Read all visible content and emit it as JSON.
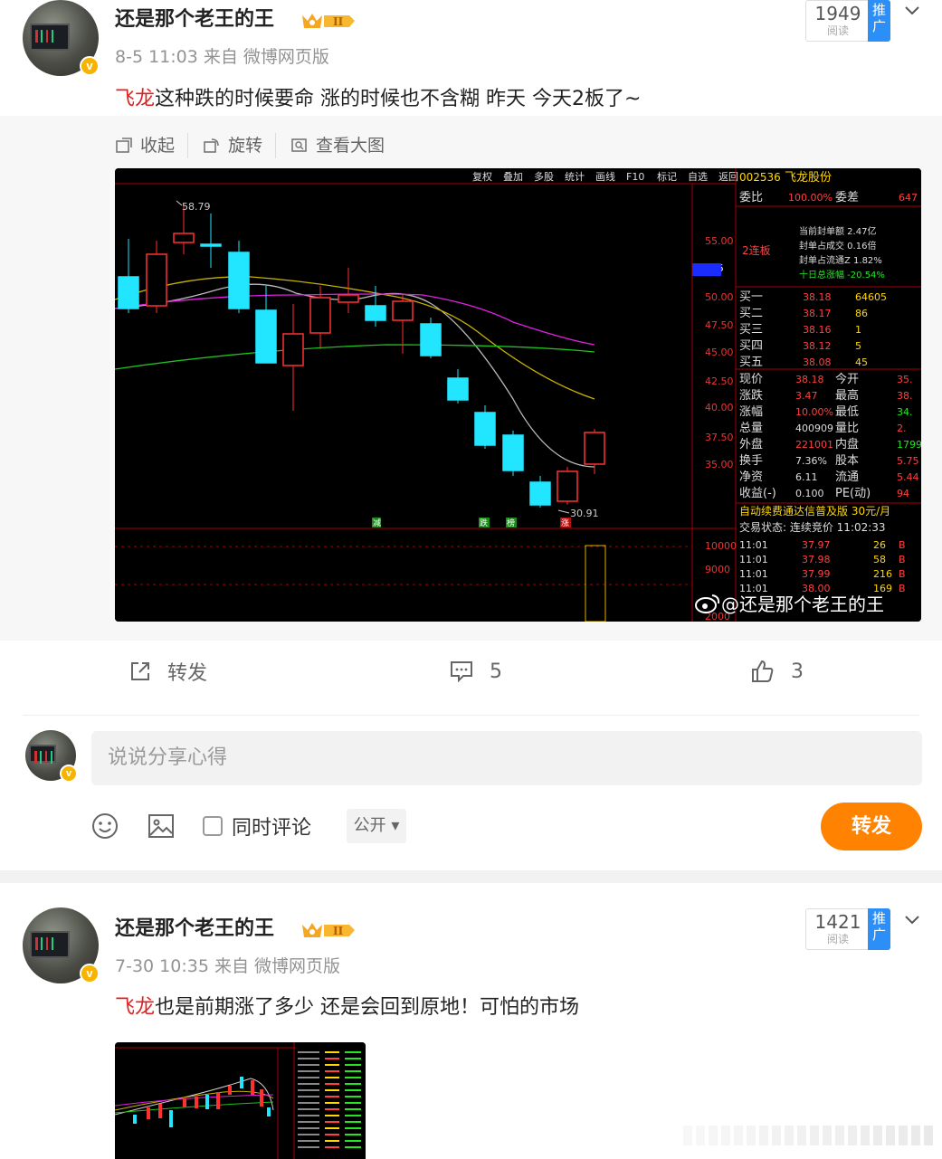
{
  "post1": {
    "username": "还是那个老王的王",
    "crown_label": "II",
    "date": "8-5 11:03",
    "source": "来自 微博网页版",
    "reads": "1949",
    "reads_label": "阅读",
    "promote": "推广",
    "text_hl": "飞龙",
    "text": "这种跌的时候要命  涨的时候也不含糊  昨天 今天2板了~",
    "tools": [
      "收起",
      "旋转",
      "查看大图"
    ],
    "repost_label": "转发",
    "comments": "5",
    "likes": "3",
    "watermark": "@还是那个老王的王",
    "comment_placeholder": "说说分享心得",
    "also_comment": "同时评论",
    "visibility": "公开",
    "forward_button": "转发"
  },
  "stock": {
    "toolbar": [
      "复权",
      "叠加",
      "多股",
      "统计",
      "画线",
      "F10",
      "标记",
      "自选",
      "返回"
    ],
    "code": "002536",
    "name": "飞龙股份",
    "weibi_label": "委比",
    "weibi_value": "100.00%",
    "weicha_label": "委差",
    "weicha_value": "647",
    "lianban": "2连板",
    "seal_info": [
      "当前封单额 2.47亿",
      "封单占成交 0.16倍",
      "封单占流通Z 1.82%",
      "十日总涨幅 -20.54%"
    ],
    "bids": [
      {
        "label": "买一",
        "price": "38.18",
        "vol": "64605"
      },
      {
        "label": "买二",
        "price": "38.17",
        "vol": "86"
      },
      {
        "label": "买三",
        "price": "38.16",
        "vol": "1"
      },
      {
        "label": "买四",
        "price": "38.12",
        "vol": "5"
      },
      {
        "label": "买五",
        "price": "38.08",
        "vol": "45"
      }
    ],
    "stats": [
      {
        "l1": "现价",
        "v1": "38.18",
        "l2": "今开",
        "v2": "35."
      },
      {
        "l1": "涨跌",
        "v1": "3.47",
        "l2": "最高",
        "v2": "38."
      },
      {
        "l1": "涨幅",
        "v1": "10.00%",
        "l2": "最低",
        "v2": "34."
      },
      {
        "l1": "总量",
        "v1": "400909",
        "l2": "量比",
        "v2": "2."
      },
      {
        "l1": "外盘",
        "v1": "221001",
        "l2": "内盘",
        "v2": "1799"
      },
      {
        "l1": "换手",
        "v1": "7.36%",
        "l2": "股本",
        "v2": "5.75"
      },
      {
        "l1": "净资",
        "v1": "6.11",
        "l2": "流通",
        "v2": "5.44"
      },
      {
        "l1": "收益(-)",
        "v1": "0.100",
        "l2": "PE(动)",
        "v2": "94"
      }
    ],
    "ad": "自动续费通达信普及版  30元/月",
    "trade_status": "交易状态: 连续竞价 11:02:33",
    "ticks": [
      {
        "t": "11:01",
        "p": "37.97",
        "v": "26",
        "s": "B"
      },
      {
        "t": "11:01",
        "p": "37.98",
        "v": "58",
        "s": "B"
      },
      {
        "t": "11:01",
        "p": "37.99",
        "v": "216",
        "s": "B"
      },
      {
        "t": "11:01",
        "p": "38.00",
        "v": "169",
        "s": "B"
      }
    ],
    "axis_labels": [
      "55.00",
      "52.06",
      "50.00",
      "47.50",
      "45.00",
      "42.50",
      "40.00",
      "37.50",
      "35.00",
      "10000",
      "9000",
      "2000"
    ],
    "high_label": "58.79",
    "low_label": "30.91",
    "markers": [
      "减",
      "跌",
      "榜",
      "涨"
    ]
  },
  "post2": {
    "username": "还是那个老王的王",
    "crown_label": "II",
    "date": "7-30 10:35",
    "source": "来自 微博网页版",
    "reads": "1421",
    "reads_label": "阅读",
    "promote": "推广",
    "text_hl": "飞龙",
    "text": "也是前期涨了多少  还是会回到原地！可怕的市场"
  },
  "colors": {
    "accent": "#ff8200",
    "highlight": "#e02020",
    "promote": "#2b8ff7",
    "badge": "#f6b400"
  }
}
